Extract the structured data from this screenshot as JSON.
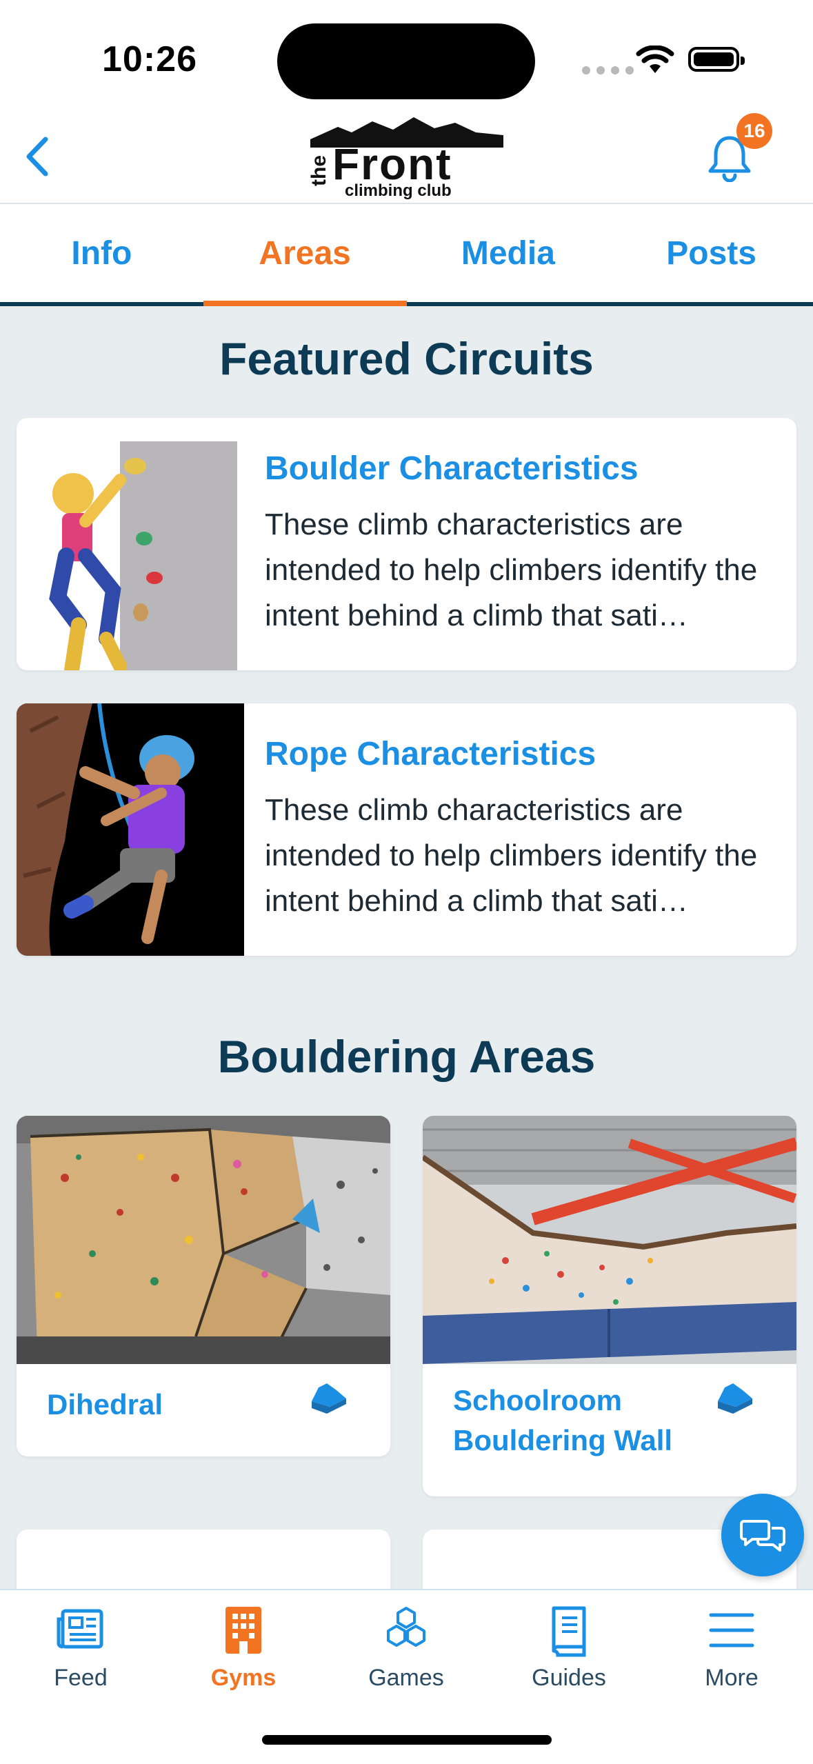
{
  "status_bar": {
    "time": "10:26"
  },
  "header": {
    "logo_top": "the",
    "logo_main": "Front",
    "logo_sub": "climbing club",
    "notification_count": "16"
  },
  "tabs": [
    {
      "label": "Info",
      "active": false
    },
    {
      "label": "Areas",
      "active": true
    },
    {
      "label": "Media",
      "active": false
    },
    {
      "label": "Posts",
      "active": false
    }
  ],
  "featured": {
    "title": "Featured Circuits",
    "items": [
      {
        "title": "Boulder Characteristics",
        "description": "These climb characteristics are intended to help climbers identify the intent behind a climb that sati…"
      },
      {
        "title": "Rope Characteristics",
        "description": "These climb characteristics are intended to help climbers identify the intent behind a climb that sati…"
      }
    ]
  },
  "bouldering": {
    "title": "Bouldering Areas",
    "areas": [
      {
        "name": "Dihedral"
      },
      {
        "name": "Schoolroom Bouldering Wall"
      }
    ]
  },
  "bottom_nav": [
    {
      "label": "Feed",
      "icon": "newspaper-icon"
    },
    {
      "label": "Gyms",
      "icon": "building-icon",
      "active": true
    },
    {
      "label": "Games",
      "icon": "hexagons-icon"
    },
    {
      "label": "Guides",
      "icon": "book-icon"
    },
    {
      "label": "More",
      "icon": "menu-icon"
    }
  ],
  "colors": {
    "accent": "#f27321",
    "link": "#1a8fe3",
    "navy": "#0d3a55",
    "background": "#e8eef0"
  }
}
